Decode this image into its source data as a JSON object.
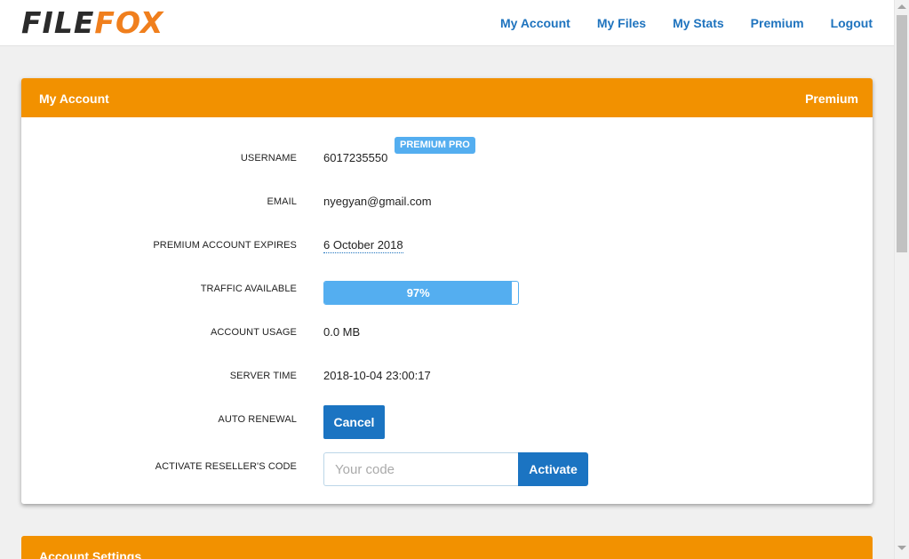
{
  "brand": {
    "file": "FILE",
    "fox": "FOX",
    "accent": "#f07f1d"
  },
  "nav": {
    "my_account": "My Account",
    "my_files": "My Files",
    "my_stats": "My Stats",
    "premium": "Premium",
    "logout": "Logout"
  },
  "account_panel": {
    "title": "My Account",
    "status": "Premium",
    "header_color": "#f29100",
    "fields": {
      "username_label": "USERNAME",
      "username_value": "6017235550",
      "badge": "PREMIUM PRO",
      "email_label": "EMAIL",
      "email_value": "nyegyan@gmail.com",
      "expires_label": "PREMIUM ACCOUNT EXPIRES",
      "expires_value": "6 October 2018",
      "traffic_label": "TRAFFIC AVAILABLE",
      "traffic_value": "97%",
      "traffic_fraction": 0.97,
      "usage_label": "ACCOUNT USAGE",
      "usage_value": "0.0 MB",
      "server_time_label": "SERVER TIME",
      "server_time_value": "2018-10-04 23:00:17",
      "auto_renewal_label": "AUTO RENEWAL",
      "cancel_button": "Cancel",
      "reseller_label": "ACTIVATE RESELLER'S CODE",
      "reseller_placeholder": "Your code",
      "activate_button": "Activate"
    }
  },
  "settings_panel": {
    "title": "Account Settings"
  },
  "colors": {
    "link": "#1e73be",
    "button": "#1b74c2",
    "badge": "#54aef0"
  }
}
